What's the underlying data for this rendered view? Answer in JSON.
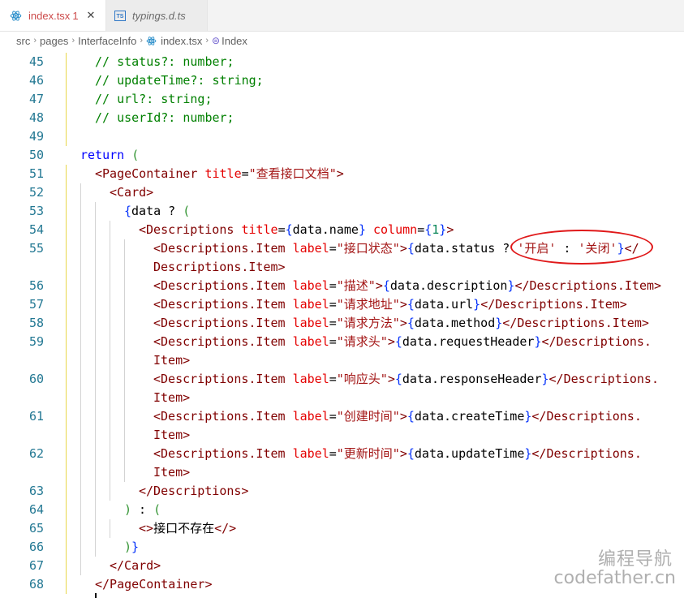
{
  "tabs": [
    {
      "label": "index.tsx",
      "problems": "1",
      "close": "✕",
      "icon": "react-icon"
    },
    {
      "label": "typings.d.ts",
      "icon": "ts-icon",
      "icon_text": "TS"
    }
  ],
  "breadcrumb": {
    "items": [
      "src",
      "pages",
      "InterfaceInfo",
      "index.tsx",
      "Index"
    ],
    "separator": "›"
  },
  "editor": {
    "lines": [
      {
        "n": "45",
        "indent": 0,
        "tokens": [
          [
            "c-comment",
            "// status?: number;"
          ]
        ]
      },
      {
        "n": "46",
        "indent": 0,
        "tokens": [
          [
            "c-comment",
            "// updateTime?: string;"
          ]
        ]
      },
      {
        "n": "47",
        "indent": 0,
        "tokens": [
          [
            "c-comment",
            "// url?: string;"
          ]
        ]
      },
      {
        "n": "48",
        "indent": 0,
        "tokens": [
          [
            "c-comment",
            "// userId?: number;"
          ]
        ]
      },
      {
        "n": "49",
        "indent": 0,
        "tokens": []
      },
      {
        "n": "50",
        "indent": -1,
        "tokens": [
          [
            "c-kw",
            "return"
          ],
          [
            "c-txt",
            " "
          ],
          [
            "c-paren",
            "("
          ]
        ]
      },
      {
        "n": "51",
        "indent": 0,
        "tokens": [
          [
            "c-tag",
            "<PageContainer"
          ],
          [
            "c-txt",
            " "
          ],
          [
            "c-attr",
            "title"
          ],
          [
            "c-txt",
            "="
          ],
          [
            "c-str",
            "\"查看接口文档\""
          ],
          [
            "c-tag",
            ">"
          ]
        ]
      },
      {
        "n": "52",
        "indent": 1,
        "tokens": [
          [
            "c-tag",
            "<Card>"
          ]
        ]
      },
      {
        "n": "53",
        "indent": 2,
        "tokens": [
          [
            "c-brace",
            "{"
          ],
          [
            "c-txt",
            "data ? "
          ],
          [
            "c-paren",
            "("
          ]
        ]
      },
      {
        "n": "54",
        "indent": 3,
        "tokens": [
          [
            "c-tag",
            "<Descriptions"
          ],
          [
            "c-txt",
            " "
          ],
          [
            "c-attr",
            "title"
          ],
          [
            "c-txt",
            "="
          ],
          [
            "c-brace",
            "{"
          ],
          [
            "c-txt",
            "data.name"
          ],
          [
            "c-brace",
            "}"
          ],
          [
            "c-txt",
            " "
          ],
          [
            "c-attr",
            "column"
          ],
          [
            "c-txt",
            "="
          ],
          [
            "c-brace",
            "{"
          ],
          [
            "c-num",
            "1"
          ],
          [
            "c-brace",
            "}"
          ],
          [
            "c-tag",
            ">"
          ]
        ]
      },
      {
        "n": "55",
        "indent": 4,
        "tokens": [
          [
            "c-tag",
            "<Descriptions.Item"
          ],
          [
            "c-txt",
            " "
          ],
          [
            "c-attr",
            "label"
          ],
          [
            "c-txt",
            "="
          ],
          [
            "c-str",
            "\"接口状态\""
          ],
          [
            "c-tag",
            ">"
          ],
          [
            "c-brace",
            "{"
          ],
          [
            "c-txt",
            "data.status ? "
          ],
          [
            "c-str",
            "'开启'"
          ],
          [
            "c-txt",
            " : "
          ],
          [
            "c-str",
            "'关闭'"
          ],
          [
            "c-brace",
            "}"
          ],
          [
            "c-tag",
            "</"
          ]
        ]
      },
      {
        "n": "",
        "indent": 4,
        "tokens": [
          [
            "c-tag",
            "Descriptions.Item>"
          ]
        ]
      },
      {
        "n": "56",
        "indent": 4,
        "tokens": [
          [
            "c-tag",
            "<Descriptions.Item"
          ],
          [
            "c-txt",
            " "
          ],
          [
            "c-attr",
            "label"
          ],
          [
            "c-txt",
            "="
          ],
          [
            "c-str",
            "\"描述\""
          ],
          [
            "c-tag",
            ">"
          ],
          [
            "c-brace",
            "{"
          ],
          [
            "c-txt",
            "data.description"
          ],
          [
            "c-brace",
            "}"
          ],
          [
            "c-tag",
            "</Descriptions.Item>"
          ]
        ]
      },
      {
        "n": "57",
        "indent": 4,
        "tokens": [
          [
            "c-tag",
            "<Descriptions.Item"
          ],
          [
            "c-txt",
            " "
          ],
          [
            "c-attr",
            "label"
          ],
          [
            "c-txt",
            "="
          ],
          [
            "c-str",
            "\"请求地址\""
          ],
          [
            "c-tag",
            ">"
          ],
          [
            "c-brace",
            "{"
          ],
          [
            "c-txt",
            "data.url"
          ],
          [
            "c-brace",
            "}"
          ],
          [
            "c-tag",
            "</Descriptions.Item>"
          ]
        ]
      },
      {
        "n": "58",
        "indent": 4,
        "tokens": [
          [
            "c-tag",
            "<Descriptions.Item"
          ],
          [
            "c-txt",
            " "
          ],
          [
            "c-attr",
            "label"
          ],
          [
            "c-txt",
            "="
          ],
          [
            "c-str",
            "\"请求方法\""
          ],
          [
            "c-tag",
            ">"
          ],
          [
            "c-brace",
            "{"
          ],
          [
            "c-txt",
            "data.method"
          ],
          [
            "c-brace",
            "}"
          ],
          [
            "c-tag",
            "</Descriptions.Item>"
          ]
        ]
      },
      {
        "n": "59",
        "indent": 4,
        "tokens": [
          [
            "c-tag",
            "<Descriptions.Item"
          ],
          [
            "c-txt",
            " "
          ],
          [
            "c-attr",
            "label"
          ],
          [
            "c-txt",
            "="
          ],
          [
            "c-str",
            "\"请求头\""
          ],
          [
            "c-tag",
            ">"
          ],
          [
            "c-brace",
            "{"
          ],
          [
            "c-txt",
            "data.requestHeader"
          ],
          [
            "c-brace",
            "}"
          ],
          [
            "c-tag",
            "</Descriptions."
          ]
        ]
      },
      {
        "n": "",
        "indent": 4,
        "tokens": [
          [
            "c-tag",
            "Item>"
          ]
        ]
      },
      {
        "n": "60",
        "indent": 4,
        "tokens": [
          [
            "c-tag",
            "<Descriptions.Item"
          ],
          [
            "c-txt",
            " "
          ],
          [
            "c-attr",
            "label"
          ],
          [
            "c-txt",
            "="
          ],
          [
            "c-str",
            "\"响应头\""
          ],
          [
            "c-tag",
            ">"
          ],
          [
            "c-brace",
            "{"
          ],
          [
            "c-txt",
            "data.responseHeader"
          ],
          [
            "c-brace",
            "}"
          ],
          [
            "c-tag",
            "</Descriptions."
          ]
        ]
      },
      {
        "n": "",
        "indent": 4,
        "tokens": [
          [
            "c-tag",
            "Item>"
          ]
        ]
      },
      {
        "n": "61",
        "indent": 4,
        "tokens": [
          [
            "c-tag",
            "<Descriptions.Item"
          ],
          [
            "c-txt",
            " "
          ],
          [
            "c-attr",
            "label"
          ],
          [
            "c-txt",
            "="
          ],
          [
            "c-str",
            "\"创建时间\""
          ],
          [
            "c-tag",
            ">"
          ],
          [
            "c-brace",
            "{"
          ],
          [
            "c-txt",
            "data.createTime"
          ],
          [
            "c-brace",
            "}"
          ],
          [
            "c-tag",
            "</Descriptions."
          ]
        ]
      },
      {
        "n": "",
        "indent": 4,
        "tokens": [
          [
            "c-tag",
            "Item>"
          ]
        ]
      },
      {
        "n": "62",
        "indent": 4,
        "tokens": [
          [
            "c-tag",
            "<Descriptions.Item"
          ],
          [
            "c-txt",
            " "
          ],
          [
            "c-attr",
            "label"
          ],
          [
            "c-txt",
            "="
          ],
          [
            "c-str",
            "\"更新时间\""
          ],
          [
            "c-tag",
            ">"
          ],
          [
            "c-brace",
            "{"
          ],
          [
            "c-txt",
            "data.updateTime"
          ],
          [
            "c-brace",
            "}"
          ],
          [
            "c-tag",
            "</Descriptions."
          ]
        ]
      },
      {
        "n": "",
        "indent": 4,
        "tokens": [
          [
            "c-tag",
            "Item>"
          ]
        ]
      },
      {
        "n": "63",
        "indent": 3,
        "tokens": [
          [
            "c-tag",
            "</Descriptions>"
          ]
        ]
      },
      {
        "n": "64",
        "indent": 2,
        "tokens": [
          [
            "c-paren",
            ")"
          ],
          [
            "c-txt",
            " : "
          ],
          [
            "c-paren",
            "("
          ]
        ]
      },
      {
        "n": "65",
        "indent": 3,
        "tokens": [
          [
            "c-tag",
            "<>"
          ],
          [
            "c-txt",
            "接口不存在"
          ],
          [
            "c-tag",
            "</>"
          ]
        ]
      },
      {
        "n": "66",
        "indent": 2,
        "tokens": [
          [
            "c-paren",
            ")"
          ],
          [
            "c-brace",
            "}"
          ]
        ]
      },
      {
        "n": "67",
        "indent": 1,
        "tokens": [
          [
            "c-tag",
            "</Card>"
          ]
        ]
      },
      {
        "n": "68",
        "indent": 0,
        "tokens": [
          [
            "c-tag",
            "</PageContainer>"
          ]
        ]
      }
    ]
  },
  "watermark": {
    "line1": "编程导航",
    "line2": "codefather.cn"
  }
}
